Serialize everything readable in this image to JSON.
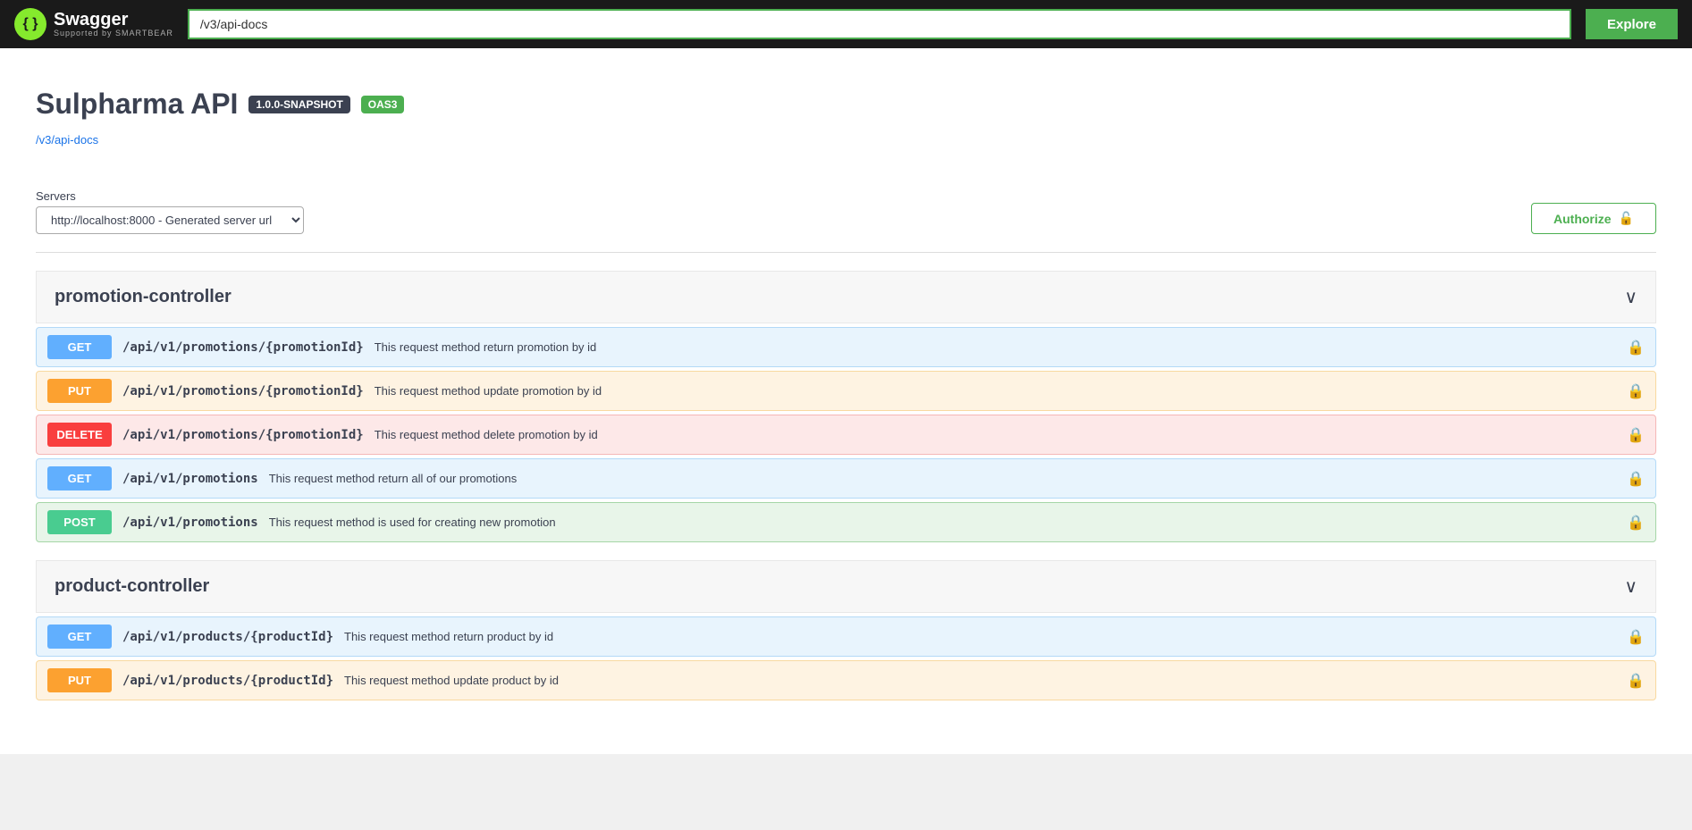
{
  "navbar": {
    "logo_icon": "{ }",
    "logo_title": "Swagger",
    "logo_subtitle": "Supported by SMARTBEAR",
    "url_value": "/v3/api-docs",
    "explore_label": "Explore"
  },
  "api_info": {
    "title": "Sulpharma API",
    "badge_snapshot": "1.0.0-SNAPSHOT",
    "badge_oas3": "OAS3",
    "api_url": "/v3/api-docs"
  },
  "servers": {
    "label": "Servers",
    "selected": "http://localhost:8000 - Generated server url",
    "options": [
      "http://localhost:8000 - Generated server url"
    ]
  },
  "authorize": {
    "label": "Authorize",
    "icon": "🔒"
  },
  "controllers": [
    {
      "name": "promotion-controller",
      "endpoints": [
        {
          "method": "GET",
          "method_class": "get",
          "path": "/api/v1/promotions/{promotionId}",
          "description": "This request method return promotion by id"
        },
        {
          "method": "PUT",
          "method_class": "put",
          "path": "/api/v1/promotions/{promotionId}",
          "description": "This request method update promotion by id"
        },
        {
          "method": "DELETE",
          "method_class": "delete",
          "path": "/api/v1/promotions/{promotionId}",
          "description": "This request method delete promotion by id"
        },
        {
          "method": "GET",
          "method_class": "get",
          "path": "/api/v1/promotions",
          "description": "This request method return all of our promotions"
        },
        {
          "method": "POST",
          "method_class": "post",
          "path": "/api/v1/promotions",
          "description": "This request method is used for creating new promotion"
        }
      ]
    },
    {
      "name": "product-controller",
      "endpoints": [
        {
          "method": "GET",
          "method_class": "get",
          "path": "/api/v1/products/{productId}",
          "description": "This request method return product by id"
        },
        {
          "method": "PUT",
          "method_class": "put",
          "path": "/api/v1/products/{productId}",
          "description": "This request method update product by id"
        }
      ]
    }
  ],
  "lock_icon": "🔒",
  "chevron_icon": "∨"
}
